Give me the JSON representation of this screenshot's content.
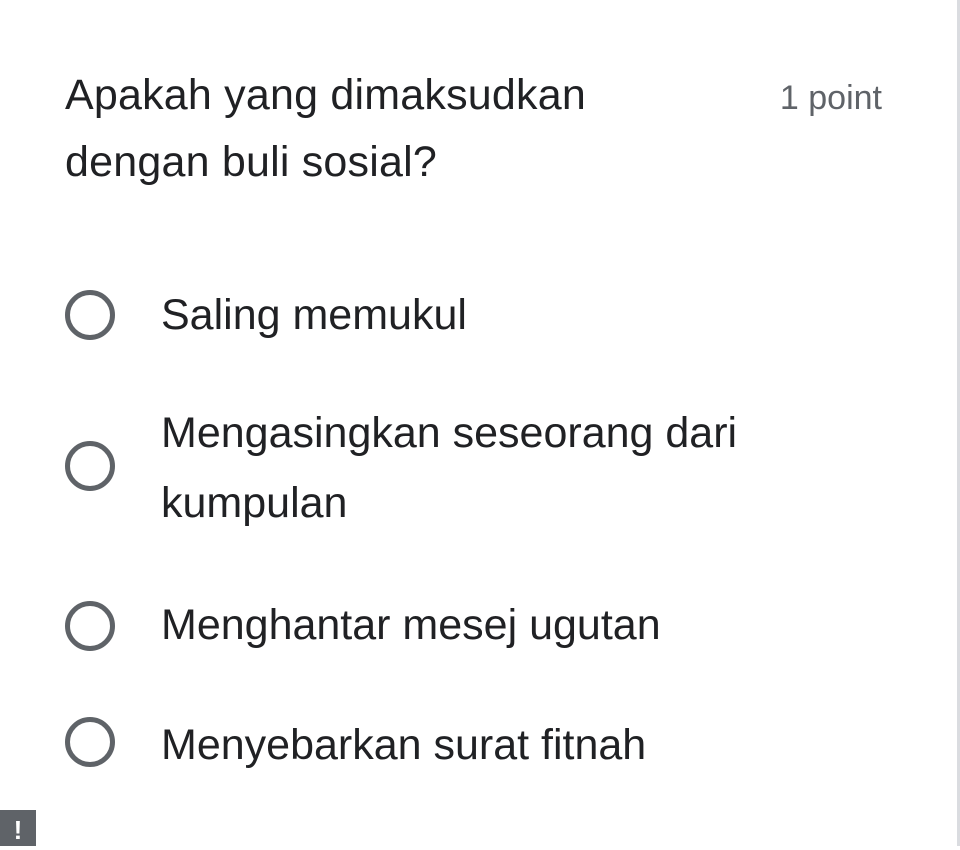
{
  "question": {
    "title": "Apakah yang dimaksudkan dengan buli sosial?",
    "points": "1 point"
  },
  "options": [
    {
      "label": "Saling memukul"
    },
    {
      "label": "Mengasingkan seseorang dari kumpulan"
    },
    {
      "label": "Menghantar mesej ugutan"
    },
    {
      "label": "Menyebarkan surat fitnah"
    }
  ],
  "corner_badge": {
    "text": "!"
  },
  "colors": {
    "text_primary": "#202124",
    "text_secondary": "#5f6368",
    "radio_border": "#5f6368",
    "card_edge": "#dadce0"
  }
}
